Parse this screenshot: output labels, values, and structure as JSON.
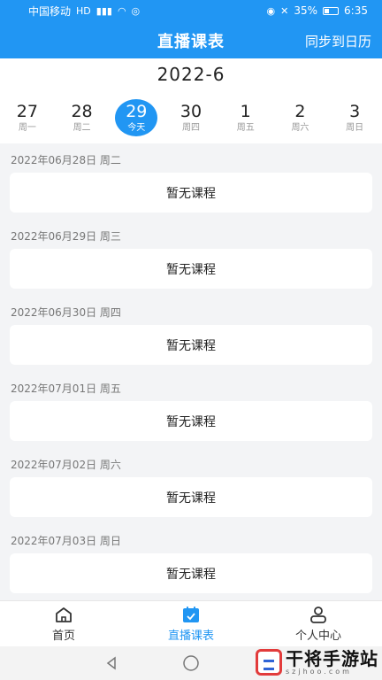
{
  "status_bar": {
    "carrier": "中国移动",
    "battery_percent": "35%",
    "time": "6:35",
    "icons": [
      "hd-icon",
      "signal-icon",
      "wifi-icon",
      "nfc-icon",
      "eye-icon",
      "mute-icon",
      "battery-icon"
    ]
  },
  "header": {
    "title": "直播课表",
    "sync_label": "同步到日历",
    "background_color": "#2196f3"
  },
  "calendar": {
    "month": "2022-6",
    "days": [
      {
        "num": "27",
        "weekday": "周一",
        "active": false
      },
      {
        "num": "28",
        "weekday": "周二",
        "active": false
      },
      {
        "num": "29",
        "weekday": "今天",
        "active": true
      },
      {
        "num": "30",
        "weekday": "周四",
        "active": false
      },
      {
        "num": "1",
        "weekday": "周五",
        "active": false
      },
      {
        "num": "2",
        "weekday": "周六",
        "active": false
      },
      {
        "num": "3",
        "weekday": "周日",
        "active": false
      }
    ]
  },
  "schedule": [
    {
      "date": "2022年06月28日 周二",
      "content": "暂无课程"
    },
    {
      "date": "2022年06月29日 周三",
      "content": "暂无课程"
    },
    {
      "date": "2022年06月30日 周四",
      "content": "暂无课程"
    },
    {
      "date": "2022年07月01日 周五",
      "content": "暂无课程"
    },
    {
      "date": "2022年07月02日 周六",
      "content": "暂无课程"
    },
    {
      "date": "2022年07月03日 周日",
      "content": "暂无课程"
    }
  ],
  "tabs": [
    {
      "label": "首页",
      "icon": "home-icon",
      "active": false
    },
    {
      "label": "直播课表",
      "icon": "calendar-icon",
      "active": true
    },
    {
      "label": "个人中心",
      "icon": "user-icon",
      "active": false
    }
  ],
  "watermark": {
    "text": "干将手游站",
    "subtext": "szjhoo.com"
  }
}
